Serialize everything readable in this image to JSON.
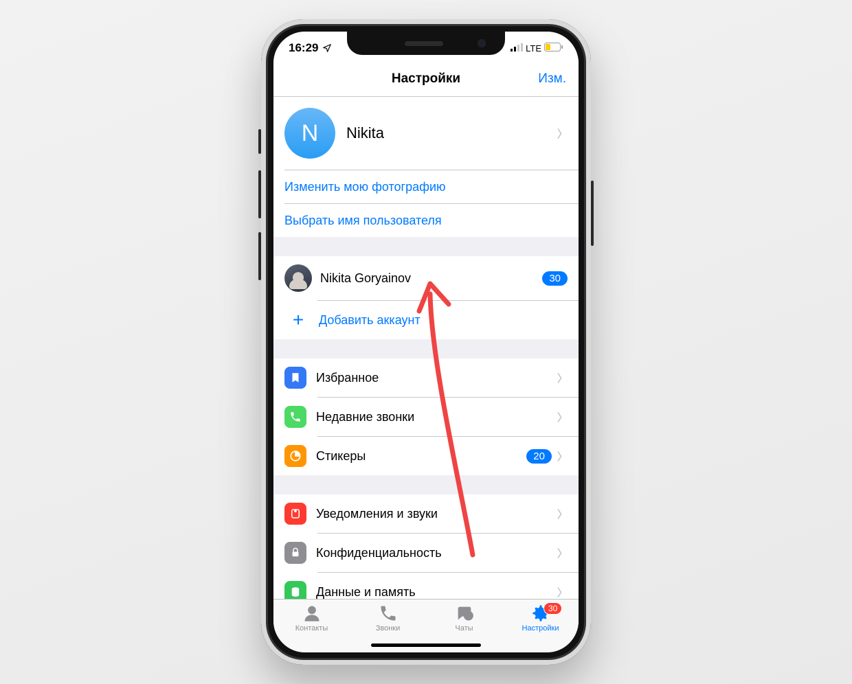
{
  "status": {
    "time": "16:29",
    "network": "LTE"
  },
  "navbar": {
    "title": "Настройки",
    "edit": "Изм."
  },
  "profile": {
    "initial": "N",
    "name": "Nikita"
  },
  "profileLinks": {
    "changePhoto": "Изменить мою фотографию",
    "chooseUsername": "Выбрать имя пользователя"
  },
  "accounts": {
    "primary": {
      "name": "Nikita Goryainov",
      "badge": "30"
    },
    "add": "Добавить аккаунт"
  },
  "settings1": {
    "saved": "Избранное",
    "recentCalls": "Недавние звонки",
    "stickers": "Стикеры",
    "stickersBadge": "20"
  },
  "settings2": {
    "notifications": "Уведомления и звуки",
    "privacy": "Конфиденциальность",
    "dataStorage": "Данные и память"
  },
  "tabs": {
    "contacts": "Контакты",
    "calls": "Звонки",
    "chats": "Чаты",
    "settings": "Настройки",
    "settingsBadge": "30"
  },
  "colors": {
    "link": "#007aff",
    "saved": "#3478f6",
    "calls": "#4cd964",
    "stickers": "#ff9500",
    "notifications": "#ff3b30",
    "privacy": "#8e8e93",
    "data": "#34c759"
  }
}
